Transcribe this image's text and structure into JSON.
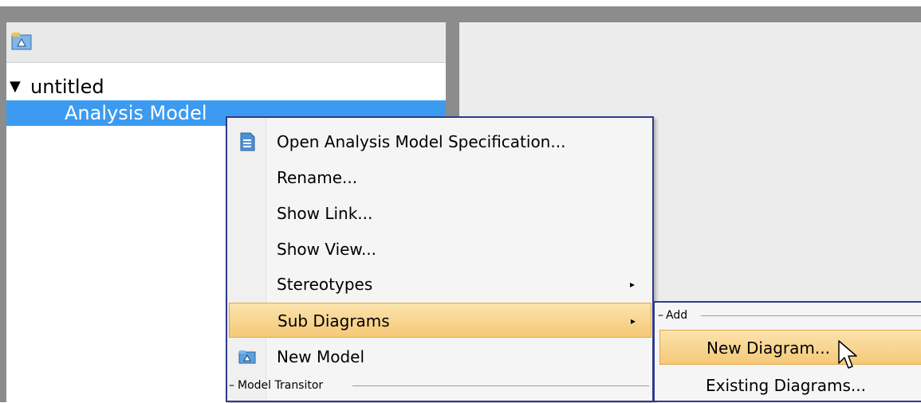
{
  "tree": {
    "root_label": "untitled",
    "child_label": "Analysis Model"
  },
  "context_menu": {
    "items": [
      {
        "label": "Open Analysis Model Specification...",
        "icon": "specification-icon"
      },
      {
        "label": "Rename..."
      },
      {
        "label": "Show Link..."
      },
      {
        "label": "Show View..."
      },
      {
        "label": "Stereotypes",
        "has_submenu": true
      },
      {
        "label": "Sub Diagrams",
        "has_submenu": true,
        "selected": true
      },
      {
        "label": "New Model",
        "icon": "model-icon"
      }
    ],
    "section_label": "Model Transitor",
    "submenu_arrow": "▸"
  },
  "submenu": {
    "section_label": "Add",
    "items": [
      {
        "label": "New Diagram...",
        "selected": true
      },
      {
        "label": "Existing Diagrams..."
      }
    ]
  },
  "colors": {
    "selection_blue": "#3c9bf0",
    "menu_highlight": "#f5c978",
    "menu_border": "#2e3a8c"
  }
}
